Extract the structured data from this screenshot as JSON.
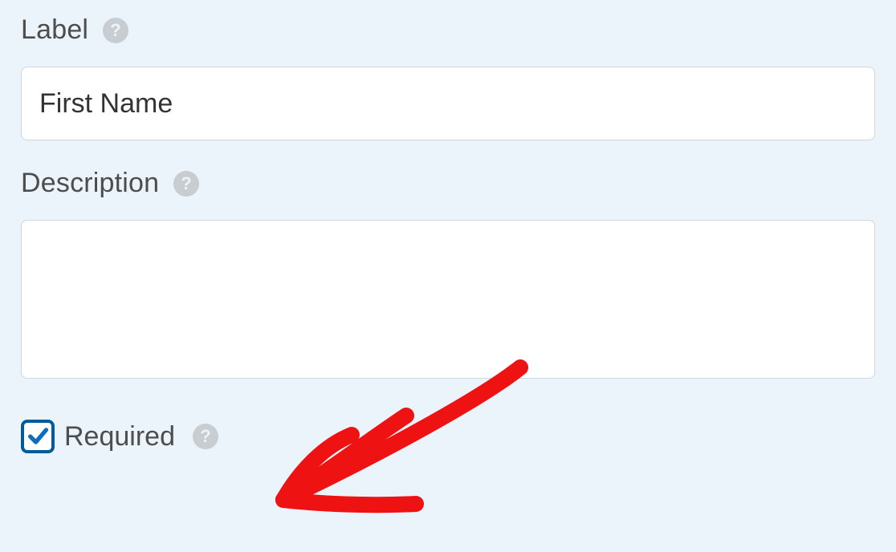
{
  "fields": {
    "label": {
      "title": "Label",
      "value": "First Name"
    },
    "description": {
      "title": "Description",
      "value": ""
    },
    "required": {
      "label": "Required",
      "checked": true
    }
  },
  "colors": {
    "checkbox_border": "#005b9a",
    "checkbox_check": "#0e6dbf",
    "annotation": "#ef1212"
  }
}
